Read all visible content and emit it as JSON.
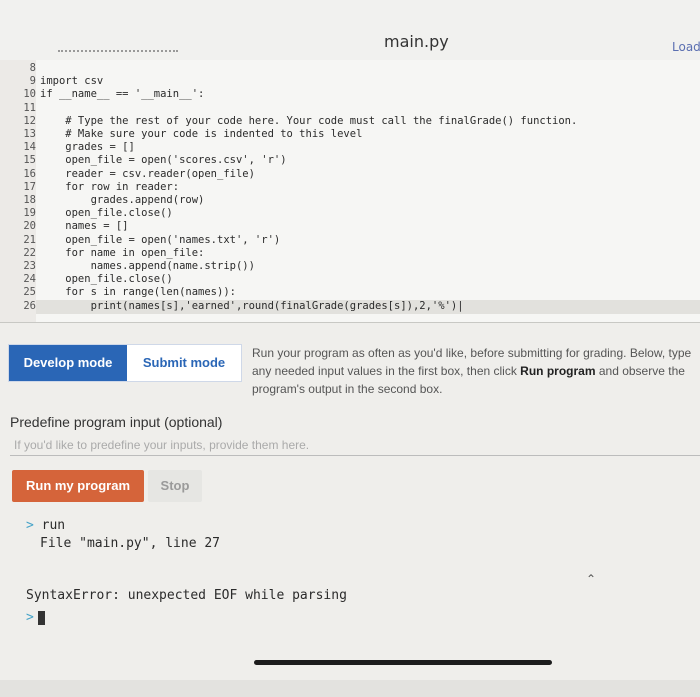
{
  "header": {
    "filename": "main.py",
    "load_label": "Load"
  },
  "editor": {
    "lines": [
      {
        "num": "8",
        "code": ""
      },
      {
        "num": "9",
        "code": "import csv"
      },
      {
        "num": "10",
        "code": "if __name__ == '__main__':"
      },
      {
        "num": "11",
        "code": ""
      },
      {
        "num": "12",
        "code": "    # Type the rest of your code here. Your code must call the finalGrade() function."
      },
      {
        "num": "13",
        "code": "    # Make sure your code is indented to this level"
      },
      {
        "num": "14",
        "code": "    grades = []"
      },
      {
        "num": "15",
        "code": "    open_file = open('scores.csv', 'r')"
      },
      {
        "num": "16",
        "code": "    reader = csv.reader(open_file)"
      },
      {
        "num": "17",
        "code": "    for row in reader:"
      },
      {
        "num": "18",
        "code": "        grades.append(row)"
      },
      {
        "num": "19",
        "code": "    open_file.close()"
      },
      {
        "num": "20",
        "code": "    names = []"
      },
      {
        "num": "21",
        "code": "    open_file = open('names.txt', 'r')"
      },
      {
        "num": "22",
        "code": "    for name in open_file:"
      },
      {
        "num": "23",
        "code": "        names.append(name.strip())"
      },
      {
        "num": "24",
        "code": "    open_file.close()"
      },
      {
        "num": "25",
        "code": "    for s in range(len(names)):"
      },
      {
        "num": "26",
        "code": "        print(names[s],'earned',round(finalGrade(grades[s]),2,'%')|"
      }
    ]
  },
  "modes": {
    "develop": "Develop mode",
    "submit": "Submit mode"
  },
  "help": {
    "text_1": "Run your program as often as you'd like, before submitting for grading. Below, type any needed input values in the first box, then click ",
    "bold": "Run program",
    "text_2": " and observe the program's output in the second box."
  },
  "predefine": {
    "title": "Predefine program input (optional)",
    "placeholder": "If you'd like to predefine your inputs, provide them here."
  },
  "buttons": {
    "run": "Run my program",
    "stop": "Stop"
  },
  "console": {
    "line1": "run",
    "line2": "File \"main.py\", line 27",
    "error": "SyntaxError: unexpected EOF while parsing"
  },
  "colors": {
    "accent_blue": "#2a66b6",
    "run_orange": "#d5643a"
  }
}
